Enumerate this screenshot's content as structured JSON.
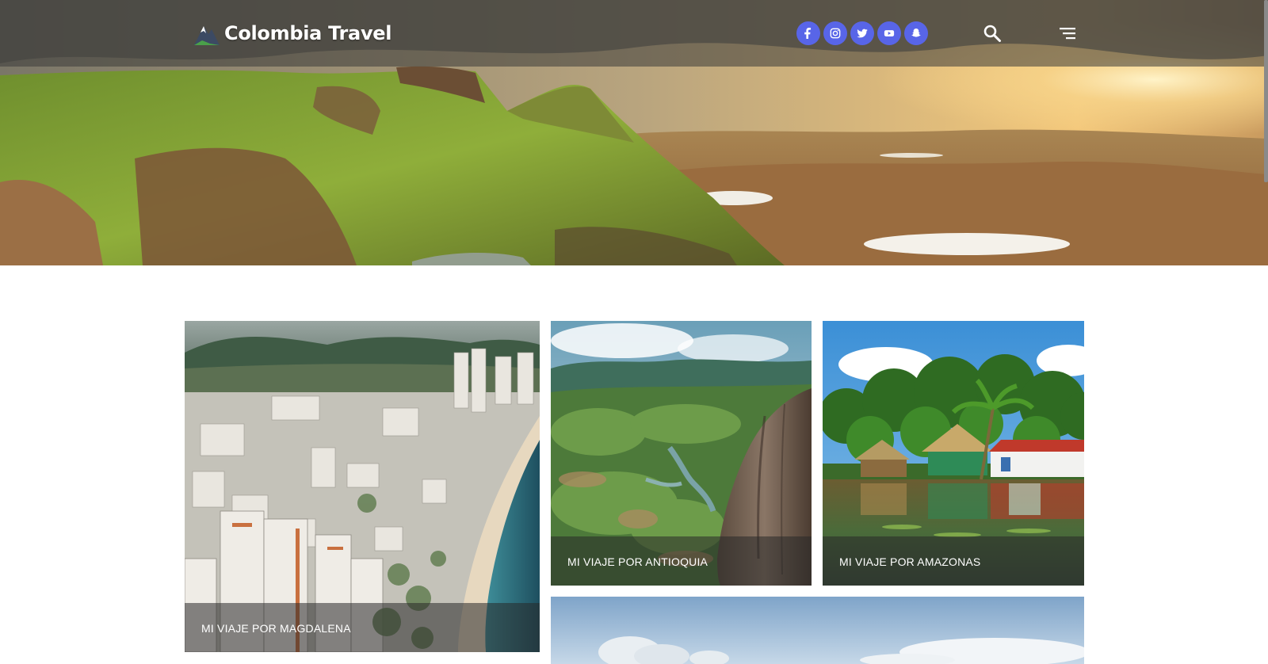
{
  "header": {
    "brand": "Colombia Travel",
    "logo_icon": "mountain-icon",
    "social_links": [
      {
        "name": "facebook",
        "icon": "facebook-icon"
      },
      {
        "name": "instagram",
        "icon": "instagram-icon"
      },
      {
        "name": "twitter",
        "icon": "twitter-icon"
      },
      {
        "name": "youtube",
        "icon": "youtube-icon"
      },
      {
        "name": "snapchat",
        "icon": "snapchat-icon"
      }
    ],
    "search_icon": "search-icon",
    "menu_icon": "menu-icon",
    "social_color": "#5865e8"
  },
  "hero": {
    "image": "mountain-valley-sunset-photo"
  },
  "posts": [
    {
      "title": "MI VIAJE POR MAGDALENA",
      "image": "coastal-city-beach-photo"
    },
    {
      "title": "MI VIAJE POR ANTIOQUIA",
      "image": "guatape-rock-lakes-photo"
    },
    {
      "title": "MI VIAJE POR AMAZONAS",
      "image": "amazon-river-huts-photo"
    },
    {
      "title": "",
      "image": "sky-clouds-photo"
    }
  ]
}
